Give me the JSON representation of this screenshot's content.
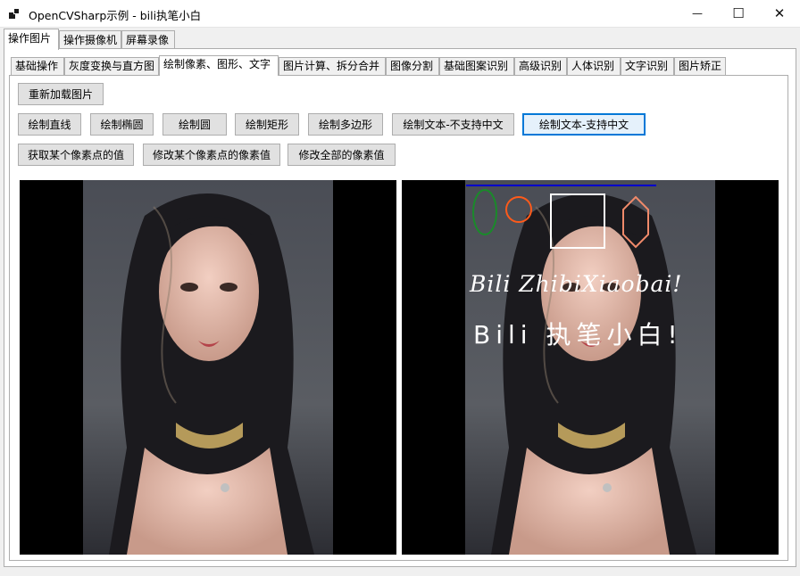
{
  "window": {
    "title": "OpenCVSharp示例 - bili执笔小白",
    "minimize_glyph": "—",
    "maximize_glyph": "☐",
    "close_glyph": "✕"
  },
  "main_tabs": [
    "操作图片",
    "操作摄像机",
    "屏幕录像"
  ],
  "sub_tabs": [
    "基础操作",
    "灰度变换与直方图",
    "绘制像素、图形、文字",
    "图片计算、拆分合并",
    "图像分割",
    "基础图案识别",
    "高级识别",
    "人体识别",
    "文字识别",
    "图片矫正"
  ],
  "buttons": {
    "reload": "重新加载图片",
    "draw_line": "绘制直线",
    "draw_ellipse": "绘制椭圆",
    "draw_circle": "绘制圆",
    "draw_rect": "绘制矩形",
    "draw_polygon": "绘制多边形",
    "draw_text_no_cn": "绘制文本-不支持中文",
    "draw_text_cn": "绘制文本-支持中文",
    "get_pixel": "获取某个像素点的值",
    "set_pixel": "修改某个像素点的像素值",
    "set_all_pixels": "修改全部的像素值"
  },
  "overlay_text": {
    "line1": "Bili ZhibiXiaobai!",
    "line2": "Bili 执笔小白!"
  },
  "colors": {
    "focus_blue": "#0078d7",
    "line_blue": "#0000cc",
    "ellipse_green": "#1a8a2a",
    "circle_orange": "#ff5a1a",
    "polygon_salmon": "#f08a6a"
  }
}
